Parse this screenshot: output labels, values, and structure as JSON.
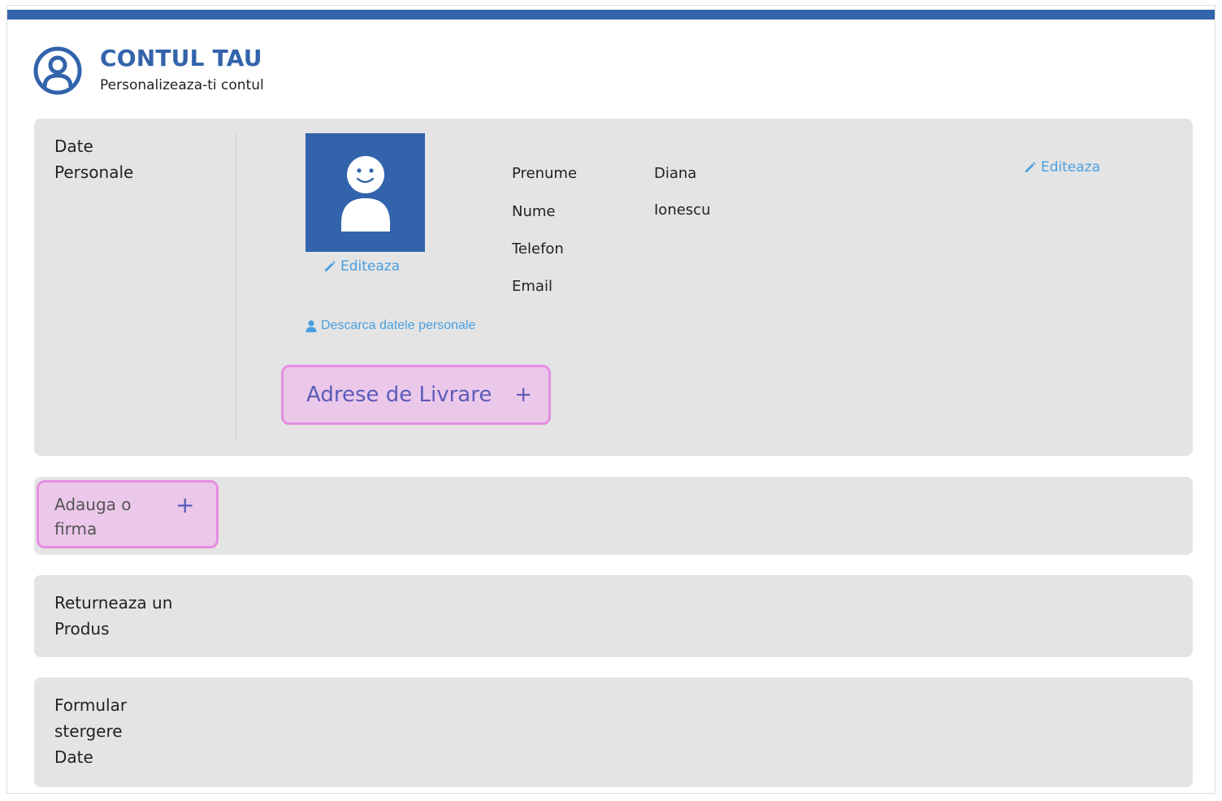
{
  "header": {
    "title": "CONTUL TAU",
    "subtitle": "Personalizeaza-ti contul",
    "icon": "user-circle-icon"
  },
  "personal": {
    "section_label": "Date\nPersonale",
    "avatar_edit_label": "Editeaza",
    "download_label": "Descarca datele personale",
    "edit_label": "Editeaza",
    "fields": [
      {
        "label": "Prenume",
        "value": "Diana"
      },
      {
        "label": "Nume",
        "value": "Ionescu"
      },
      {
        "label": "Telefon",
        "value": ""
      },
      {
        "label": "Email",
        "value": ""
      }
    ],
    "shipping_label": "Adrese de Livrare",
    "plus": "+"
  },
  "firm": {
    "label": "Adauga o\nfirma",
    "plus": "+"
  },
  "return": {
    "label": "Returneaza un\nProdus"
  },
  "delete": {
    "label": "Formular\nstergere\nDate"
  },
  "colors": {
    "brand": "#3263ab",
    "link": "#4a9fe0",
    "highlight_bg": "#ebc8ea",
    "highlight_border": "#e58de2",
    "panel_bg": "#e4e4e4"
  }
}
